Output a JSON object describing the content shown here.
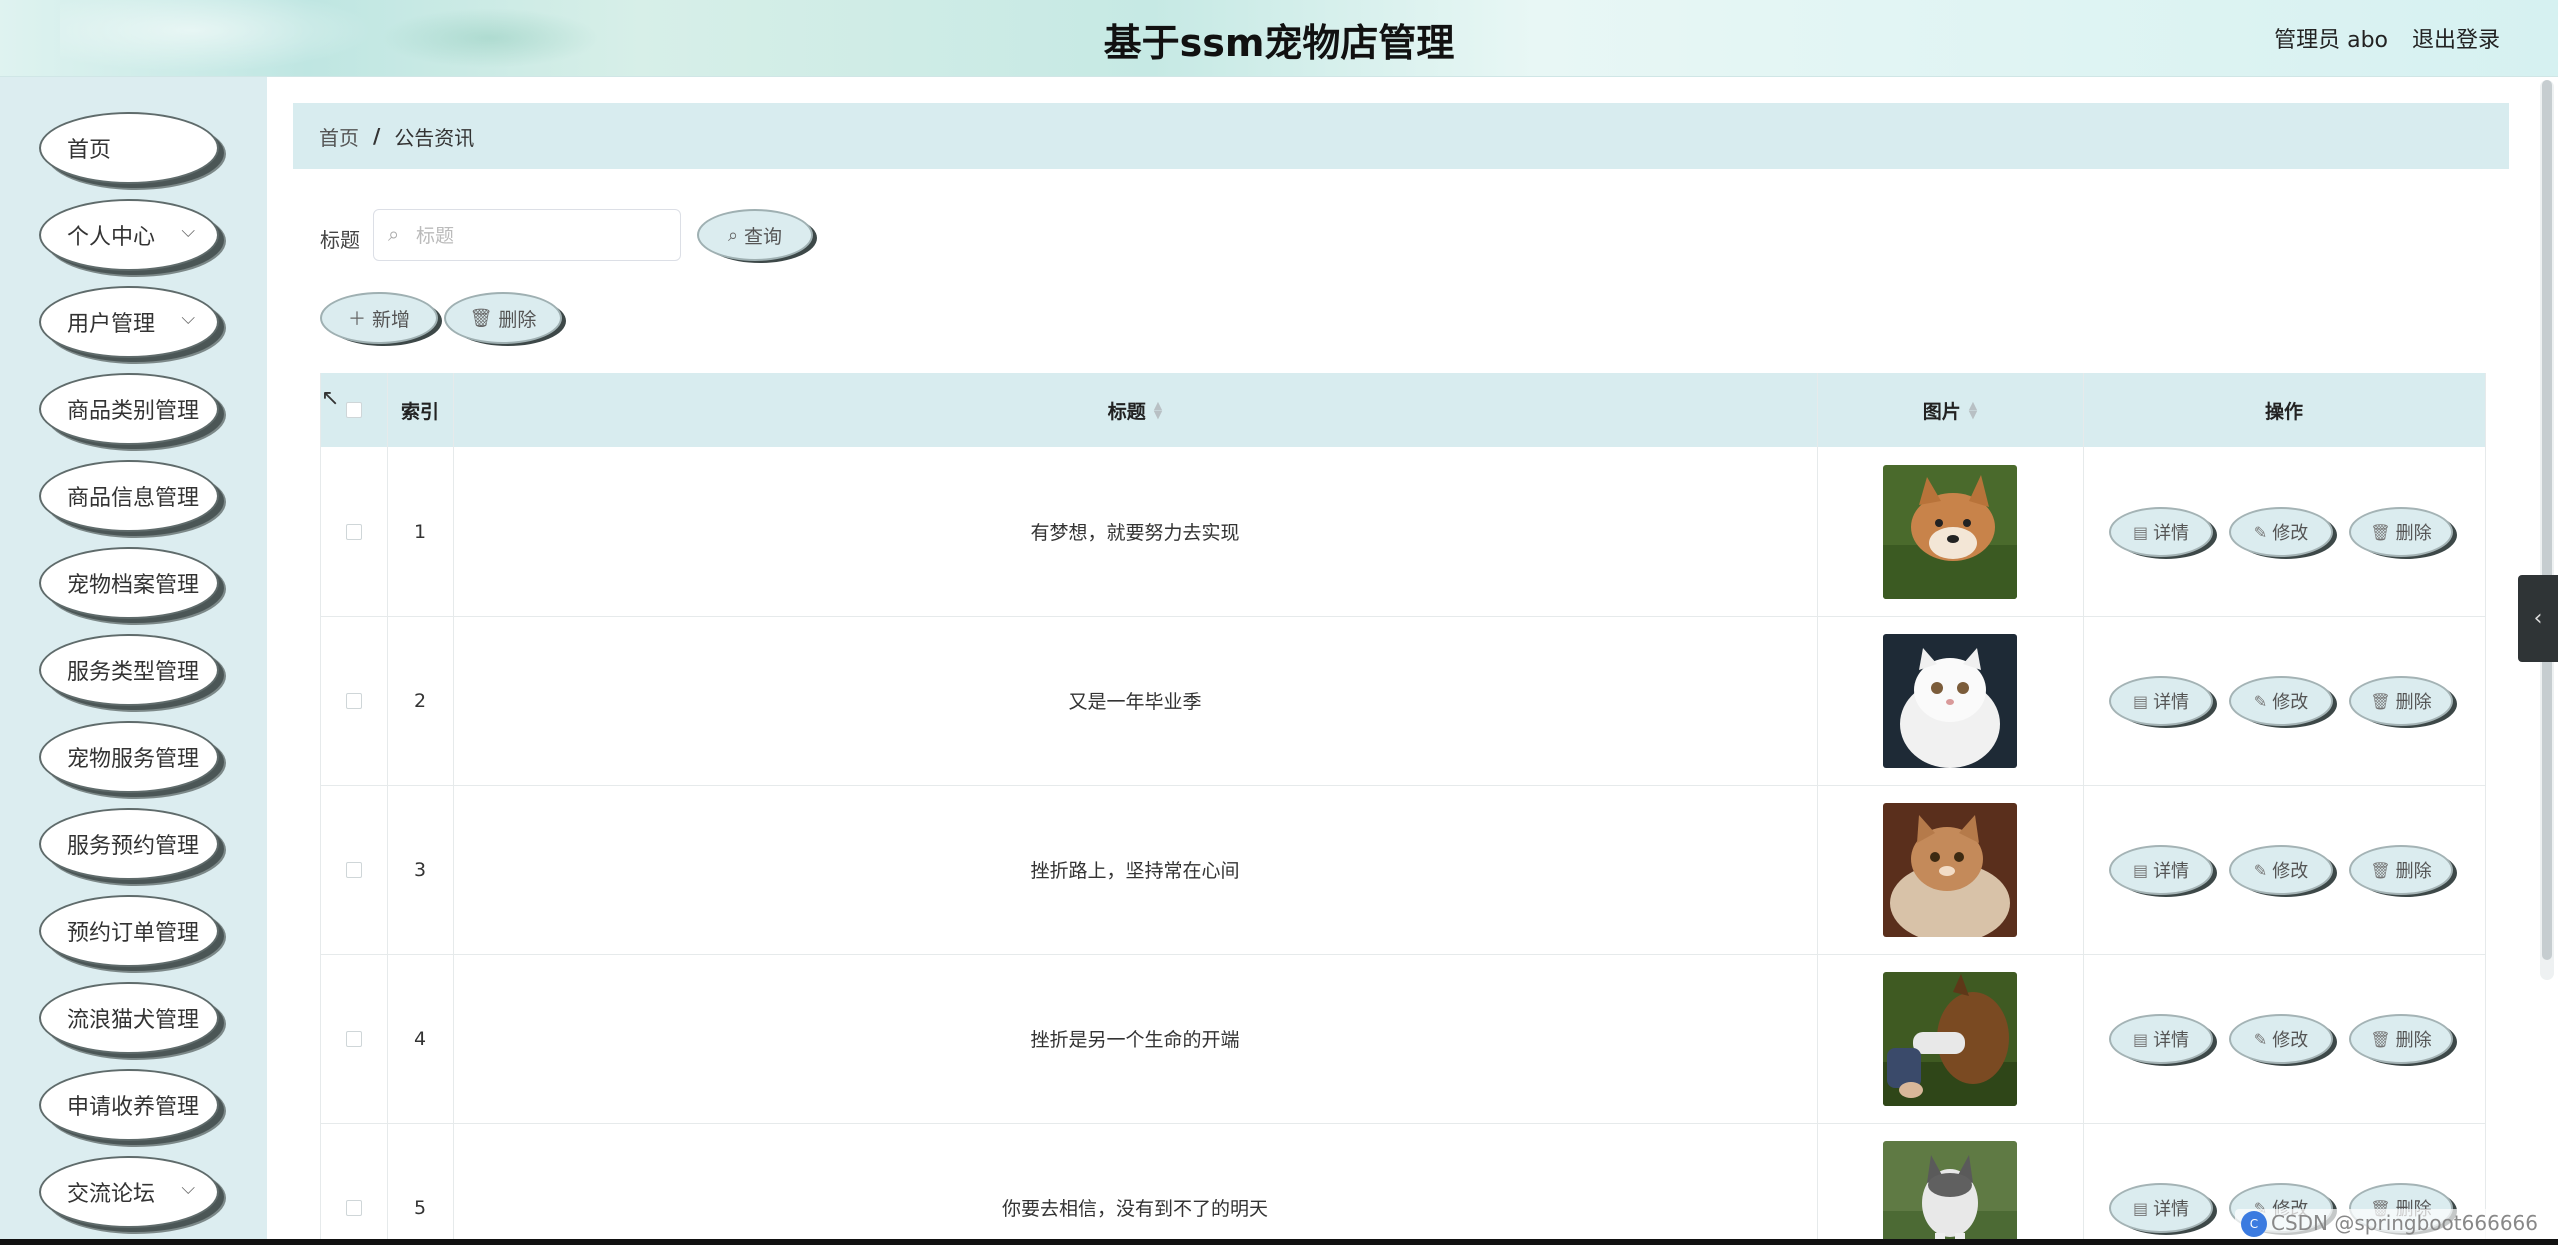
{
  "header": {
    "title": "基于ssm宠物店管理",
    "user": "管理员 abo",
    "logout": "退出登录"
  },
  "sidebar": {
    "items": [
      {
        "label": "首页",
        "has_chevron": false
      },
      {
        "label": "个人中心",
        "has_chevron": true
      },
      {
        "label": "用户管理",
        "has_chevron": true
      },
      {
        "label": "商品类别管理",
        "has_chevron": false
      },
      {
        "label": "商品信息管理",
        "has_chevron": false
      },
      {
        "label": "宠物档案管理",
        "has_chevron": false
      },
      {
        "label": "服务类型管理",
        "has_chevron": false
      },
      {
        "label": "宠物服务管理",
        "has_chevron": false
      },
      {
        "label": "服务预约管理",
        "has_chevron": false
      },
      {
        "label": "预约订单管理",
        "has_chevron": false
      },
      {
        "label": "流浪猫犬管理",
        "has_chevron": false
      },
      {
        "label": "申请收养管理",
        "has_chevron": false
      },
      {
        "label": "交流论坛",
        "has_chevron": true
      }
    ]
  },
  "breadcrumb": {
    "home": "首页",
    "separator": "/",
    "current": "公告资讯"
  },
  "search": {
    "label": "标题",
    "placeholder": "标题",
    "value": "",
    "button": "查询"
  },
  "actions": {
    "add": "新增",
    "delete": "删除"
  },
  "table": {
    "columns": [
      "索引",
      "标题",
      "图片",
      "操作"
    ],
    "rows": [
      {
        "index": "1",
        "title": "有梦想，就要努力去实现",
        "image": "shiba-dog-photo"
      },
      {
        "index": "2",
        "title": "又是一年毕业季",
        "image": "white-persian-cat-photo"
      },
      {
        "index": "3",
        "title": "挫折路上，坚持常在心间",
        "image": "tabby-cat-photo"
      },
      {
        "index": "4",
        "title": "挫折是另一个生命的开端",
        "image": "dog-drinking-photo"
      },
      {
        "index": "5",
        "title": "你要去相信，没有到不了的明天",
        "image": "husky-dog-photo"
      }
    ],
    "row_actions": {
      "detail": "详情",
      "edit": "修改",
      "delete": "删除"
    }
  },
  "watermark": "CSDN @springboot666666",
  "colors": {
    "sidebar_bg": "#dcedf0",
    "header_bar_bg": "#d8ecef",
    "button_bg": "#dbecef"
  }
}
